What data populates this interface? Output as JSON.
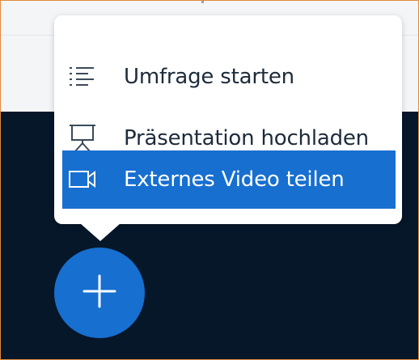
{
  "menu": {
    "items": [
      {
        "label": "Umfrage starten",
        "icon": "list-icon",
        "selected": false
      },
      {
        "label": "Präsentation hochladen",
        "icon": "presentation-icon",
        "selected": false
      },
      {
        "label": "Externes Video teilen",
        "icon": "video-camera-icon",
        "selected": true
      }
    ]
  },
  "fab": {
    "icon": "plus-icon"
  },
  "colors": {
    "accent": "#176fd0",
    "dark_background": "#06172a",
    "menu_text": "#1d2b3a",
    "frame_border": "#e08a3c"
  }
}
